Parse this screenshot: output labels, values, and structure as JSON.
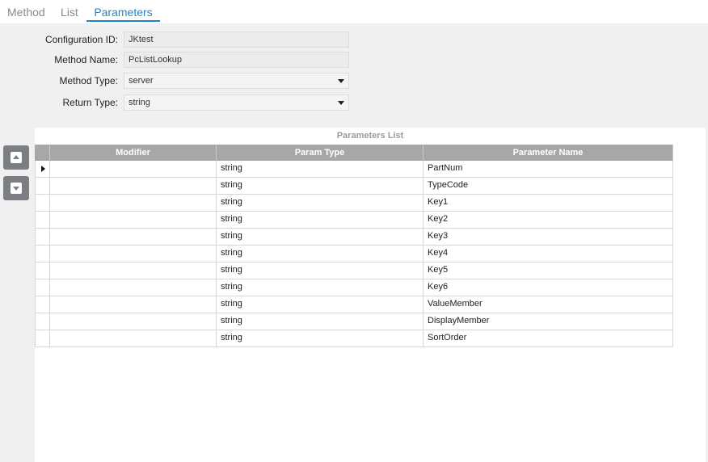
{
  "tabs": [
    {
      "label": "Method",
      "active": false
    },
    {
      "label": "List",
      "active": false
    },
    {
      "label": "Parameters",
      "active": true
    }
  ],
  "colors": {
    "accent": "#1f86c6",
    "header_bg": "#a7a7a7",
    "button_bg": "#7b7f83"
  },
  "form": {
    "config_id": {
      "label": "Configuration ID:",
      "value": "JKtest"
    },
    "method_name": {
      "label": "Method Name:",
      "value": "PcListLookup"
    },
    "method_type": {
      "label": "Method Type:",
      "value": "server"
    },
    "return_type": {
      "label": "Return Type:",
      "value": "string"
    }
  },
  "side_buttons": {
    "up_icon": "move-up-icon",
    "down_icon": "move-down-icon"
  },
  "parameters_list": {
    "title": "Parameters List",
    "columns": [
      "Modifier",
      "Param Type",
      "Parameter Name"
    ],
    "rows": [
      {
        "modifier": "",
        "type": "string",
        "name": "PartNum",
        "current": true
      },
      {
        "modifier": "",
        "type": "string",
        "name": "TypeCode",
        "current": false
      },
      {
        "modifier": "",
        "type": "string",
        "name": "Key1",
        "current": false
      },
      {
        "modifier": "",
        "type": "string",
        "name": "Key2",
        "current": false
      },
      {
        "modifier": "",
        "type": "string",
        "name": "Key3",
        "current": false
      },
      {
        "modifier": "",
        "type": "string",
        "name": "Key4",
        "current": false
      },
      {
        "modifier": "",
        "type": "string",
        "name": "Key5",
        "current": false
      },
      {
        "modifier": "",
        "type": "string",
        "name": "Key6",
        "current": false
      },
      {
        "modifier": "",
        "type": "string",
        "name": "ValueMember",
        "current": false
      },
      {
        "modifier": "",
        "type": "string",
        "name": "DisplayMember",
        "current": false
      },
      {
        "modifier": "",
        "type": "string",
        "name": "SortOrder",
        "current": false
      }
    ]
  }
}
